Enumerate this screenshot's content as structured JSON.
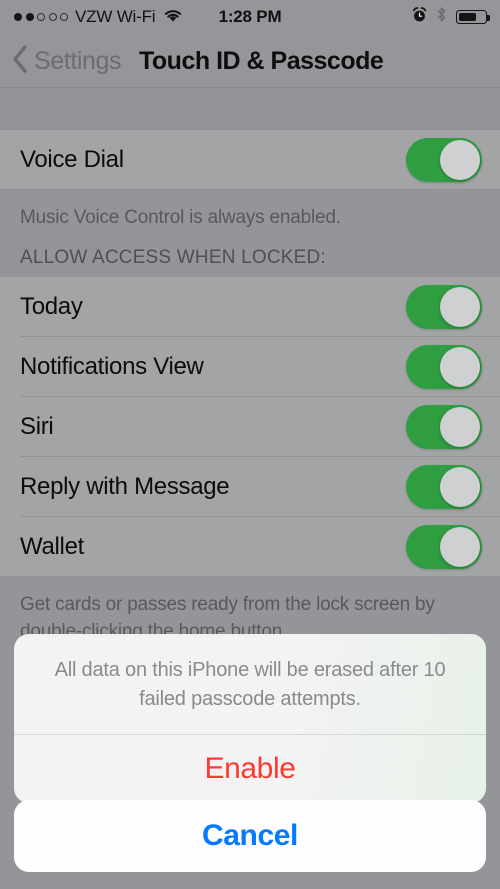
{
  "status_bar": {
    "signal_dots_filled": 2,
    "signal_dots_total": 5,
    "carrier": "VZW Wi-Fi",
    "wifi_icon": "wifi-icon",
    "time": "1:28 PM",
    "alarm_icon": "alarm-clock-icon",
    "bluetooth_icon": "bluetooth-icon",
    "battery_icon": "battery-icon",
    "battery_percent": 65
  },
  "nav_bar": {
    "back_icon": "chevron-left-icon",
    "back_label": "Settings",
    "title": "Touch ID & Passcode"
  },
  "voice_dial_section": {
    "rows": [
      {
        "label": "Voice Dial",
        "toggle": "on"
      }
    ],
    "footer": "Music Voice Control is always enabled."
  },
  "allow_access_section": {
    "header": "ALLOW ACCESS WHEN LOCKED:",
    "rows": [
      {
        "label": "Today",
        "toggle": "on"
      },
      {
        "label": "Notifications View",
        "toggle": "on"
      },
      {
        "label": "Siri",
        "toggle": "on"
      },
      {
        "label": "Reply with Message",
        "toggle": "on"
      },
      {
        "label": "Wallet",
        "toggle": "on"
      }
    ],
    "footer": "Get cards or passes ready from the lock screen by double-clicking the home button."
  },
  "action_sheet": {
    "title": "All data on this iPhone will be erased after 10 failed passcode attempts.",
    "enable_label": "Enable",
    "cancel_label": "Cancel"
  },
  "colors": {
    "toggle_on": "#2f9e41",
    "destructive": "#fc3b30",
    "tint_blue": "#067aff",
    "cell_background": "#a3a4a6",
    "page_background": "#939598"
  }
}
